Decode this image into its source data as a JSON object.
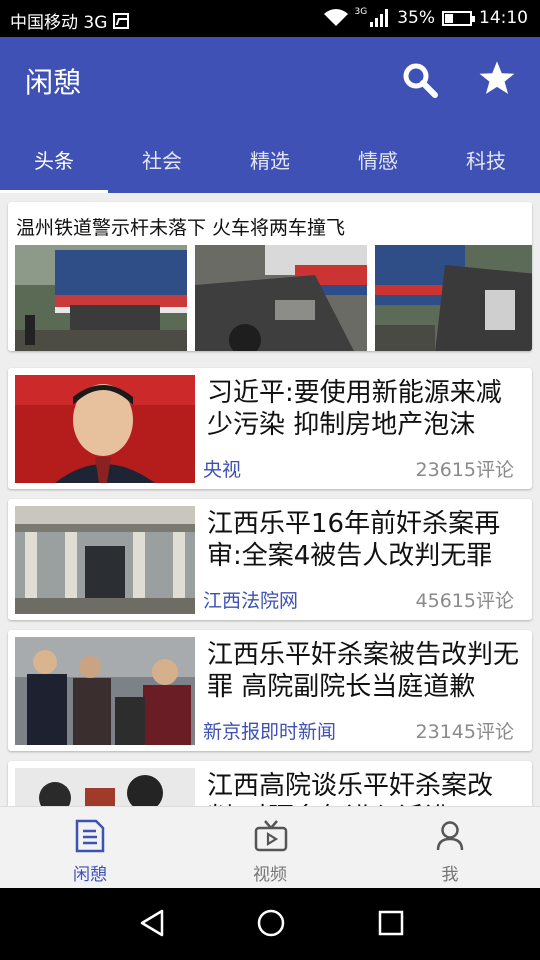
{
  "status_bar": {
    "carrier": "中国移动 3G",
    "network_badge": "3G",
    "battery": "35%",
    "time": "14:10"
  },
  "app_bar": {
    "title": "闲憩",
    "icons": [
      "search-icon",
      "star-icon"
    ]
  },
  "tabs": [
    {
      "label": "头条",
      "active": true
    },
    {
      "label": "社会",
      "active": false
    },
    {
      "label": "精选",
      "active": false
    },
    {
      "label": "情感",
      "active": false
    },
    {
      "label": "科技",
      "active": false
    }
  ],
  "feed": {
    "gallery_card": {
      "headline": "温州铁道警示杆未落下 火车将两车撞飞"
    },
    "news": [
      {
        "title": "习近平:要使用新能源来减少污染 抑制房地产泡沫",
        "source": "央视",
        "comments": "23615评论"
      },
      {
        "title": "江西乐平16年前奸杀案再审:全案4被告人改判无罪",
        "source": "江西法院网",
        "comments": "45615评论"
      },
      {
        "title": "江西乐平奸杀案被告改判无罪 高院副院长当庭道歉",
        "source": "新京报即时新闻",
        "comments": "23145评论"
      },
      {
        "title": "江西高院谈乐平奸杀案改判:时隔多年进入诉讼",
        "source": "",
        "comments": ""
      }
    ]
  },
  "bottom_nav": [
    {
      "label": "闲憩",
      "icon": "article-icon",
      "active": true
    },
    {
      "label": "视频",
      "icon": "video-icon",
      "active": false
    },
    {
      "label": "我",
      "icon": "person-icon",
      "active": false
    }
  ],
  "colors": {
    "primary": "#3f51b5",
    "status_bar": "#000000",
    "feed_background": "#eeeeee",
    "comment_gray": "#8a8a8a"
  }
}
